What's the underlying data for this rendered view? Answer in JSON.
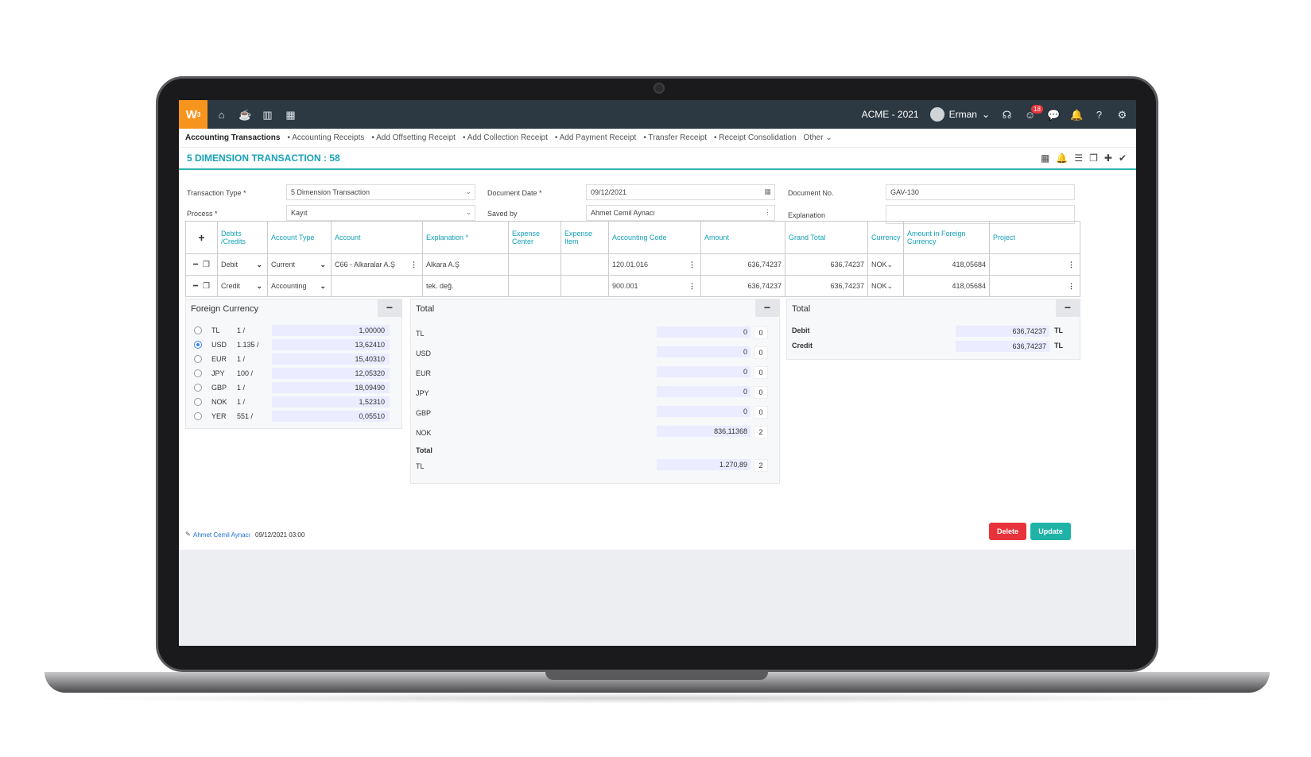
{
  "app": {
    "logo": "W",
    "logo_sup": "3",
    "company": "ACME - 2021",
    "user": "Erman",
    "notifications": "18"
  },
  "tabs": [
    "Accounting Transactions",
    "• Accounting Receipts",
    "• Add Offsetting Receipt",
    "• Add Collection Receipt",
    "• Add Payment Receipt",
    "• Transfer Receipt",
    "• Receipt Consolidation",
    "Other"
  ],
  "page": {
    "title": "5 DIMENSION TRANSACTION : 58"
  },
  "form": {
    "transaction_type_label": "Transaction Type *",
    "transaction_type": "5 Dimension Transaction",
    "process_label": "Process *",
    "process": "Kayıt",
    "document_date_label": "Document Date *",
    "document_date": "09/12/2021",
    "saved_by_label": "Saved by",
    "saved_by": "Ahmet Cemil Aynacı",
    "document_no_label": "Document No.",
    "document_no": "GAV-130",
    "explanation_label": "Explanation",
    "explanation": ""
  },
  "grid": {
    "headers": [
      "Debits /Credits",
      "Account Type",
      "Account",
      "Explanation *",
      "Expense Center",
      "Expense Item",
      "Accounting Code",
      "Amount",
      "Grand Total",
      "Currency",
      "Amount in Foreign Currency",
      "Project"
    ],
    "rows": [
      {
        "dc": "Debit",
        "account_type": "Current",
        "account": "C66 - Alkaralar A.Ş",
        "explanation": "Alkara A.Ş",
        "expense_center": "",
        "expense_item": "",
        "code": "120.01.016",
        "amount": "636,74237",
        "grand_total": "636,74237",
        "currency": "NOK",
        "foreign_amount": "418,05684",
        "project": ""
      },
      {
        "dc": "Credit",
        "account_type": "Accounting",
        "account": "",
        "explanation": "tek. değ.",
        "expense_center": "",
        "expense_item": "",
        "code": "900.001",
        "amount": "636,74237",
        "grand_total": "636,74237",
        "currency": "NOK",
        "foreign_amount": "418,05684",
        "project": ""
      }
    ]
  },
  "foreign_currency": {
    "title": "Foreign Currency",
    "rows": [
      {
        "code": "TL",
        "rate": "1 /",
        "value": "1,00000",
        "selected": false
      },
      {
        "code": "USD",
        "rate": "1.135 /",
        "value": "13,62410",
        "selected": true
      },
      {
        "code": "EUR",
        "rate": "1 /",
        "value": "15,40310",
        "selected": false
      },
      {
        "code": "JPY",
        "rate": "100 /",
        "value": "12,05320",
        "selected": false
      },
      {
        "code": "GBP",
        "rate": "1 /",
        "value": "18,09490",
        "selected": false
      },
      {
        "code": "NOK",
        "rate": "1 /",
        "value": "1,52310",
        "selected": false
      },
      {
        "code": "YER",
        "rate": "551 /",
        "value": "0,05510",
        "selected": false
      }
    ]
  },
  "total_middle": {
    "title": "Total",
    "rows": [
      {
        "code": "TL",
        "value": "0",
        "count": "0"
      },
      {
        "code": "USD",
        "value": "0",
        "count": "0"
      },
      {
        "code": "EUR",
        "value": "0",
        "count": "0"
      },
      {
        "code": "JPY",
        "value": "0",
        "count": "0"
      },
      {
        "code": "GBP",
        "value": "0",
        "count": "0"
      },
      {
        "code": "NOK",
        "value": "836,11368",
        "count": "2"
      }
    ],
    "total_label": "Total",
    "total_row": {
      "code": "TL",
      "value": "1.270,89",
      "count": "2"
    }
  },
  "total_right": {
    "title": "Total",
    "rows": [
      {
        "label": "Debit",
        "value": "636,74237",
        "cur": "TL"
      },
      {
        "label": "Credit",
        "value": "636,74237",
        "cur": "TL"
      }
    ]
  },
  "footer": {
    "user": "Ahmet Cemil Aynacı",
    "date": "09/12/2021 03:00",
    "delete": "Delete",
    "update": "Update"
  },
  "colors": {
    "accent": "#17a2b8",
    "delete": "#e8333c",
    "update": "#1fb3a8",
    "topbar": "#2d3942",
    "logo": "#f7941d"
  }
}
